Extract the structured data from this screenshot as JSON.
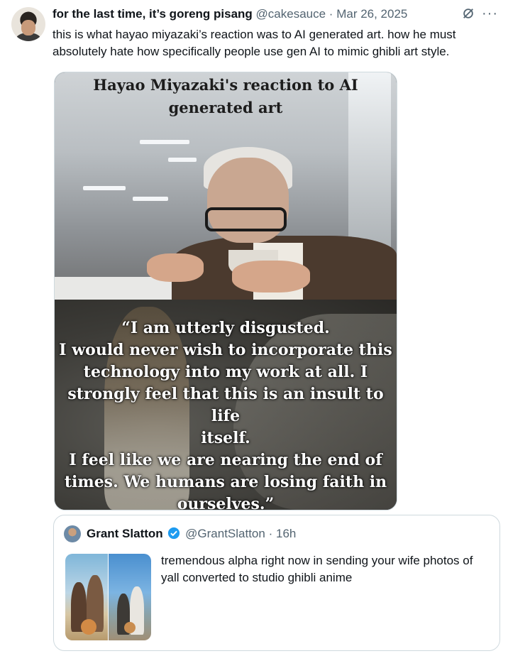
{
  "tweet": {
    "author_name": "for the last time, it’s goreng pisang",
    "handle": "@cakesauce",
    "separator": "·",
    "date": "Mar 26, 2025",
    "text": "this is what hayao miyazaki’s reaction was to AI generated art. how he must absolutely hate how specifically people use gen AI to mimic ghibli art style.",
    "icons": [
      "grok-icon",
      "more-icon"
    ],
    "media": {
      "caption_top_lines": [
        "Hayao Miyazaki's reaction to AI",
        "generated art"
      ],
      "quote_lines": [
        "“I am utterly disgusted.",
        "I would never wish to incorporate this",
        "technology into my work at all. I",
        "strongly feel that this is an insult to life",
        "itself.",
        "I feel like we are nearing the end of",
        "times. We humans are losing faith in",
        "ourselves.”"
      ]
    }
  },
  "quoted_tweet": {
    "author_name": "Grant Slatton",
    "handle": "@GrantSlatton",
    "separator": "·",
    "time": "16h",
    "text": "tremendous alpha right now in sending your wife photos of yall converted to studio ghibli anime",
    "verified_color": "#1d9bf0"
  }
}
